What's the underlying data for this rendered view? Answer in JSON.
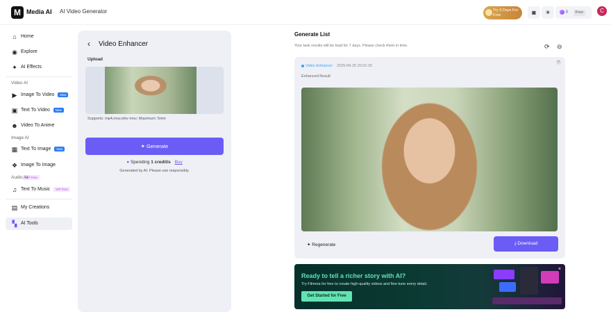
{
  "header": {
    "brand": "Media AI",
    "subtitle": "AI Video Generator",
    "trial": "Try 3 Days For Free",
    "credits": "0",
    "plan": "Free",
    "avatar_letter": "C"
  },
  "sidebar": {
    "home": "Home",
    "explore": "Explore",
    "ai_effects": "AI Effects",
    "video_ai": "Video AI",
    "image_to_video": "Image To Video",
    "text_to_video": "Text To Video",
    "video_to_anime": "Video To Anime",
    "image_ai": "Image AI",
    "text_to_image": "Text To Image",
    "image_to_image": "Image To Image",
    "audio_ai": "Audio AI",
    "text_to_music": "Text To Music",
    "my_creations": "My Creations",
    "ai_tools": "AI Tools",
    "tag_new": "New",
    "tag_vip": "VIP Free"
  },
  "panel": {
    "title": "Video Enhancer",
    "upload_label": "Upload",
    "supports": "Supports: mp4,mov,mkv mov; Maximum: 5min",
    "generate": "Generate",
    "spending_prefix": "Spending",
    "spending_amount": "1 credit/s",
    "buy": "Buy",
    "disclaimer": "Generated by AI. Please use responsibly."
  },
  "list": {
    "title": "Generate List",
    "subtitle": "Your task results will be kept for 7 days. Please check them in time.",
    "item": {
      "tool": "Video Enhancer",
      "timestamp": "2025-09-25 20:01:25",
      "result_label": "Enhanced Result",
      "regenerate": "Regenerate",
      "download": "Download"
    }
  },
  "promo": {
    "title": "Ready to tell a richer story with AI?",
    "subtitle": "Try Filmora for free to create high-quality videos and fine-tune every detail.",
    "cta": "Get Started for Free"
  },
  "colors": {
    "accent": "#6c5cf6",
    "status": "#3aa0f0",
    "promo_cta": "#62e4b2"
  }
}
